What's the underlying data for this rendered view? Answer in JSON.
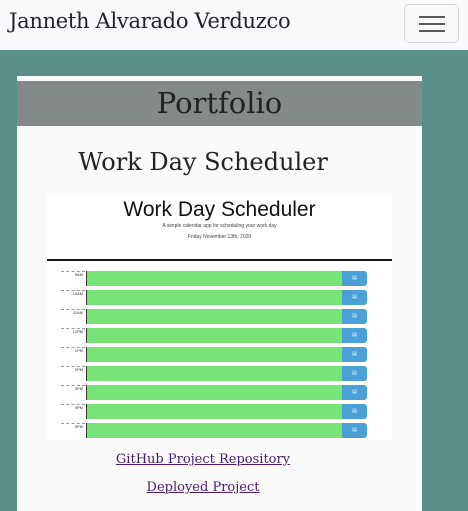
{
  "navbar": {
    "brand": "Janneth Alvarado Verduzco",
    "toggler_icon": "hamburger-menu-icon"
  },
  "section": {
    "title": "Portfolio"
  },
  "project": {
    "title": "Work Day Scheduler",
    "preview": {
      "title": "Work Day Scheduler",
      "subtitle": "A simple calendar app for scheduling your work day",
      "date": "Friday November 13th, 2020",
      "rows": [
        {
          "hour": "9AM"
        },
        {
          "hour": "10AM"
        },
        {
          "hour": "11AM"
        },
        {
          "hour": "12PM"
        },
        {
          "hour": "1PM"
        },
        {
          "hour": "2PM"
        },
        {
          "hour": "3PM"
        },
        {
          "hour": "4PM"
        },
        {
          "hour": "5PM"
        }
      ],
      "save_icon": "save-icon",
      "colors": {
        "future": "#77e377",
        "save": "#4aa1d8"
      }
    },
    "repo_link": "GitHub Project Repository",
    "deploy_link": "Deployed Project"
  },
  "colors": {
    "background": "#5b8f89",
    "navbar": "#f8f9fa",
    "card_header": "#848a8a",
    "link": "#4b1a6b"
  }
}
